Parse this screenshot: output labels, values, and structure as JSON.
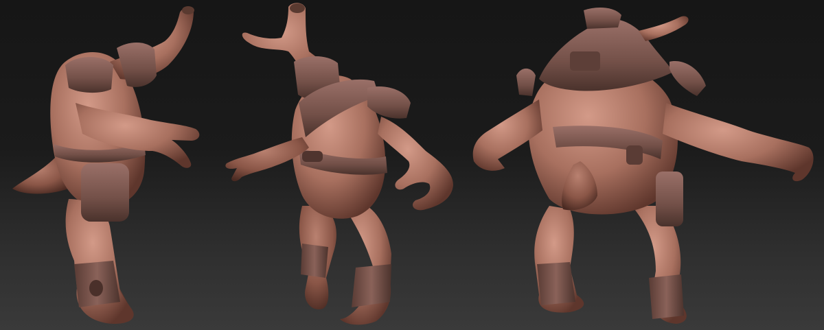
{
  "scene": {
    "background_top": "#161616",
    "background_bottom": "#3a3a3a",
    "skin_color": "#b07a6a",
    "skin_shadow": "#6e4236",
    "armor_color": "#7d5a52",
    "armor_shadow": "#4f342e"
  },
  "views": [
    {
      "name": "side-view"
    },
    {
      "name": "three-quarter-front-view"
    },
    {
      "name": "back-view"
    }
  ]
}
